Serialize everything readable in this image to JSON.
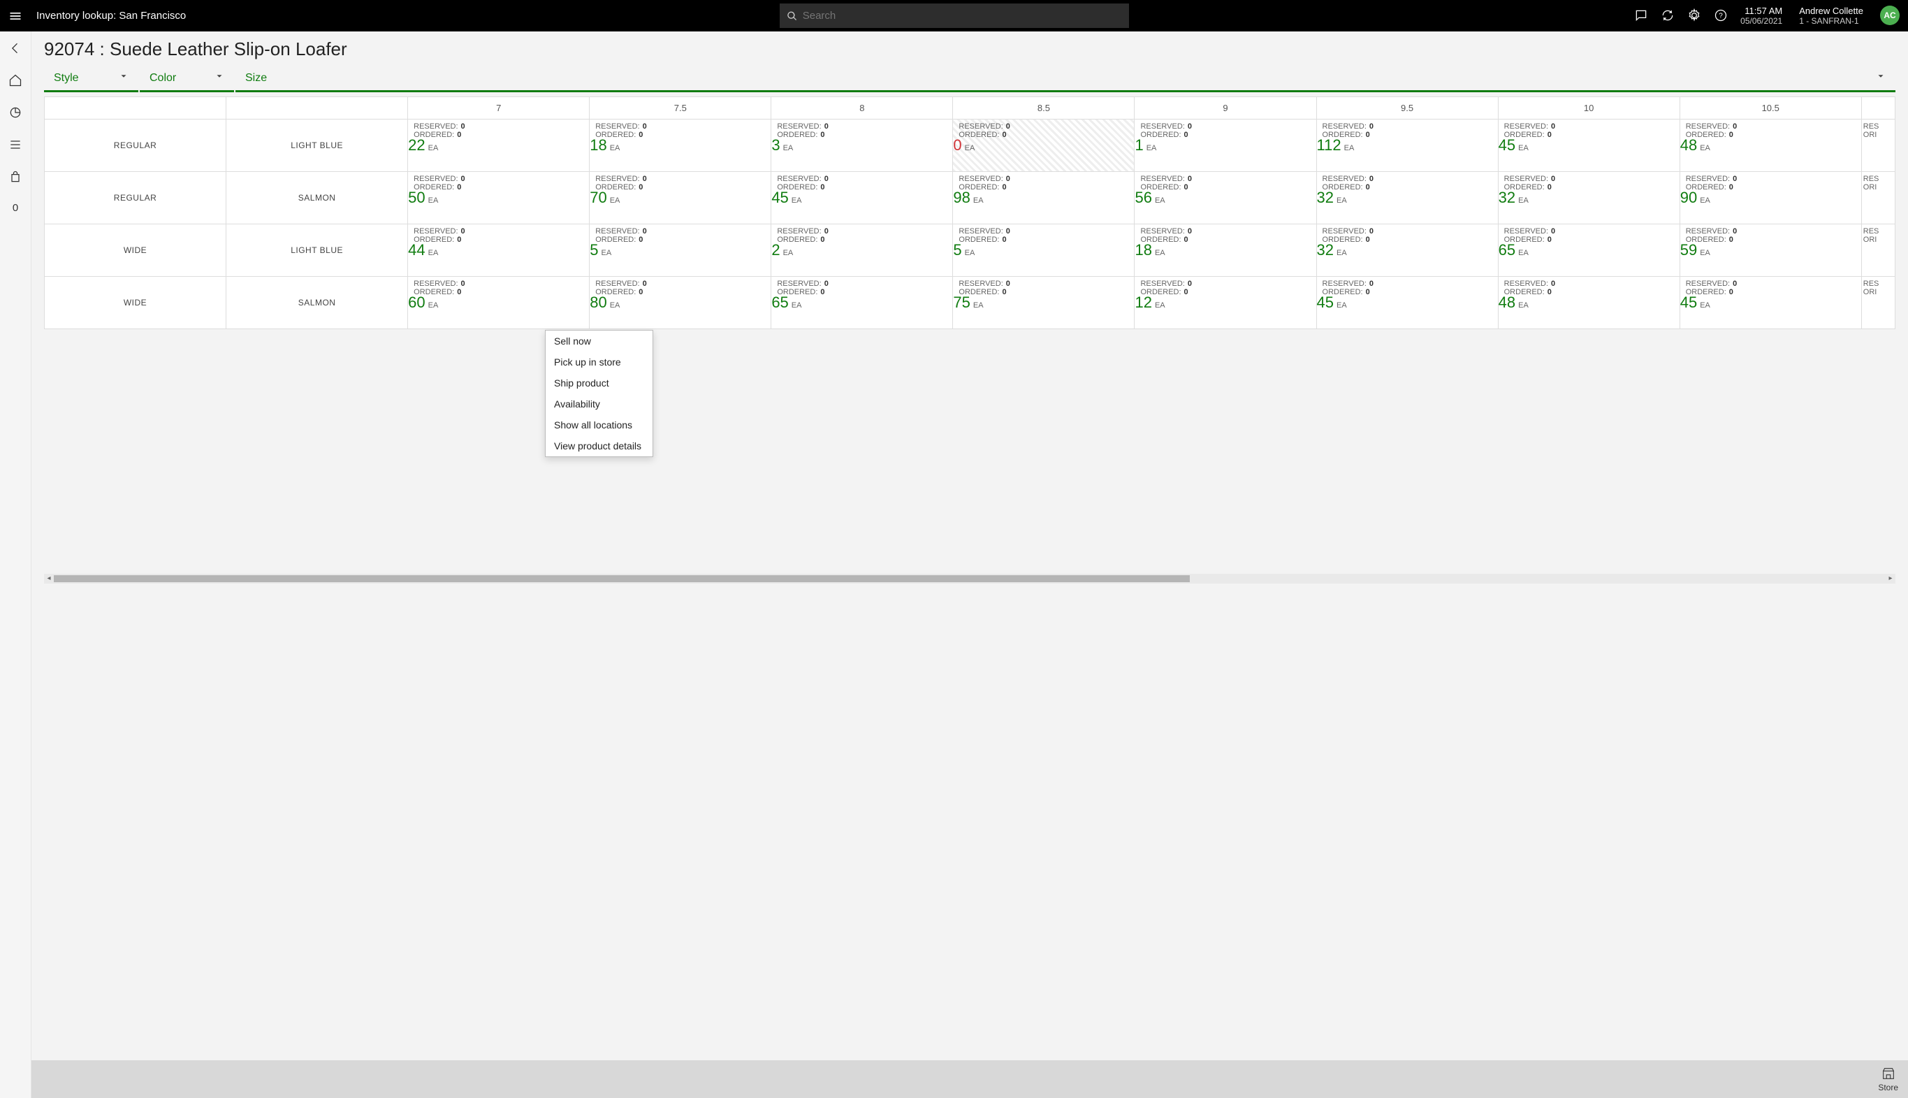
{
  "header": {
    "title": "Inventory lookup: San Francisco",
    "search_placeholder": "Search",
    "time": "11:57 AM",
    "date": "05/06/2021",
    "user_name": "Andrew Collette",
    "store": "1 - SANFRAN-1",
    "initials": "AC"
  },
  "leftnav": {
    "badge": "0"
  },
  "page": {
    "title": "92074 : Suede Leather Slip-on Loafer"
  },
  "filters": {
    "style": "Style",
    "color": "Color",
    "size": "Size"
  },
  "labels": {
    "reserved": "RESERVED:",
    "ordered": "ORDERED:",
    "unit": "EA",
    "res_partial": "RES",
    "ord_partial": "ORI"
  },
  "sizes": [
    "7",
    "7.5",
    "8",
    "8.5",
    "9",
    "9.5",
    "10",
    "10.5"
  ],
  "rows": [
    {
      "style": "REGULAR",
      "color": "LIGHT BLUE",
      "cells": [
        {
          "reserved": "0",
          "ordered": "0",
          "avail": "22",
          "neg": false
        },
        {
          "reserved": "0",
          "ordered": "0",
          "avail": "18",
          "neg": false
        },
        {
          "reserved": "0",
          "ordered": "0",
          "avail": "3",
          "neg": false
        },
        {
          "reserved": "0",
          "ordered": "0",
          "avail": "0",
          "neg": true,
          "selected": true
        },
        {
          "reserved": "0",
          "ordered": "0",
          "avail": "1",
          "neg": false
        },
        {
          "reserved": "0",
          "ordered": "0",
          "avail": "112",
          "neg": false
        },
        {
          "reserved": "0",
          "ordered": "0",
          "avail": "45",
          "neg": false
        },
        {
          "reserved": "0",
          "ordered": "0",
          "avail": "48",
          "neg": false
        }
      ]
    },
    {
      "style": "REGULAR",
      "color": "SALMON",
      "cells": [
        {
          "reserved": "0",
          "ordered": "0",
          "avail": "50",
          "neg": false
        },
        {
          "reserved": "0",
          "ordered": "0",
          "avail": "70",
          "neg": false
        },
        {
          "reserved": "0",
          "ordered": "0",
          "avail": "45",
          "neg": false
        },
        {
          "reserved": "0",
          "ordered": "0",
          "avail": "98",
          "neg": false
        },
        {
          "reserved": "0",
          "ordered": "0",
          "avail": "56",
          "neg": false
        },
        {
          "reserved": "0",
          "ordered": "0",
          "avail": "32",
          "neg": false
        },
        {
          "reserved": "0",
          "ordered": "0",
          "avail": "32",
          "neg": false
        },
        {
          "reserved": "0",
          "ordered": "0",
          "avail": "90",
          "neg": false
        }
      ]
    },
    {
      "style": "WIDE",
      "color": "LIGHT BLUE",
      "cells": [
        {
          "reserved": "0",
          "ordered": "0",
          "avail": "44",
          "neg": false
        },
        {
          "reserved": "0",
          "ordered": "0",
          "avail": "5",
          "neg": false
        },
        {
          "reserved": "0",
          "ordered": "0",
          "avail": "2",
          "neg": false
        },
        {
          "reserved": "0",
          "ordered": "0",
          "avail": "5",
          "neg": false
        },
        {
          "reserved": "0",
          "ordered": "0",
          "avail": "18",
          "neg": false
        },
        {
          "reserved": "0",
          "ordered": "0",
          "avail": "32",
          "neg": false
        },
        {
          "reserved": "0",
          "ordered": "0",
          "avail": "65",
          "neg": false
        },
        {
          "reserved": "0",
          "ordered": "0",
          "avail": "59",
          "neg": false
        }
      ]
    },
    {
      "style": "WIDE",
      "color": "SALMON",
      "cells": [
        {
          "reserved": "0",
          "ordered": "0",
          "avail": "60",
          "neg": false
        },
        {
          "reserved": "0",
          "ordered": "0",
          "avail": "80",
          "neg": false
        },
        {
          "reserved": "0",
          "ordered": "0",
          "avail": "65",
          "neg": false
        },
        {
          "reserved": "0",
          "ordered": "0",
          "avail": "75",
          "neg": false
        },
        {
          "reserved": "0",
          "ordered": "0",
          "avail": "12",
          "neg": false
        },
        {
          "reserved": "0",
          "ordered": "0",
          "avail": "45",
          "neg": false
        },
        {
          "reserved": "0",
          "ordered": "0",
          "avail": "48",
          "neg": false
        },
        {
          "reserved": "0",
          "ordered": "0",
          "avail": "45",
          "neg": false
        }
      ]
    }
  ],
  "context_menu": {
    "items": [
      "Sell now",
      "Pick up in store",
      "Ship product",
      "Availability",
      "Show all locations",
      "View product details"
    ]
  },
  "footer": {
    "store": "Store"
  }
}
